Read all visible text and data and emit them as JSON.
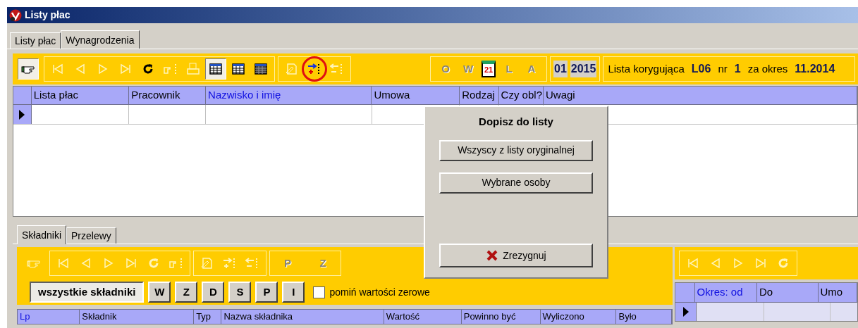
{
  "window": {
    "title": "Listy płac"
  },
  "tabs": [
    {
      "label": "Listy płac",
      "selected": false
    },
    {
      "label": "Wynagrodzenia",
      "selected": true
    }
  ],
  "toolbar": {
    "groups": [
      [
        {
          "kind": "pointer",
          "pressed": true,
          "disabled": false
        }
      ],
      [
        {
          "kind": "first",
          "pressed": false,
          "disabled": true
        },
        {
          "kind": "prev",
          "pressed": false,
          "disabled": true
        },
        {
          "kind": "next",
          "pressed": false,
          "disabled": true
        },
        {
          "kind": "last",
          "pressed": false,
          "disabled": true
        },
        {
          "kind": "refresh",
          "pressed": false,
          "disabled": false
        },
        {
          "kind": "handlist",
          "pressed": false,
          "disabled": true
        },
        {
          "kind": "printer",
          "pressed": false,
          "disabled": true
        },
        {
          "kind": "grida",
          "pressed": true,
          "disabled": false
        },
        {
          "kind": "gridb",
          "pressed": false,
          "disabled": false
        },
        {
          "kind": "gridc",
          "pressed": false,
          "disabled": false
        }
      ],
      [
        {
          "kind": "docedit",
          "pressed": false,
          "disabled": true
        },
        {
          "kind": "addlist",
          "pressed": false,
          "disabled": false,
          "highlighted": true
        },
        {
          "kind": "removelist",
          "pressed": false,
          "disabled": true
        }
      ]
    ],
    "letters": [
      {
        "label": "O",
        "kind": "letter",
        "disabled": true
      },
      {
        "label": "W",
        "kind": "letter",
        "disabled": true
      },
      {
        "kind": "calendar",
        "label": "21"
      },
      {
        "label": "L",
        "kind": "letter",
        "disabled": true
      },
      {
        "label": "A",
        "kind": "letter",
        "disabled": true
      }
    ],
    "period": {
      "month": "01",
      "year": "2015"
    },
    "info": [
      {
        "text": "Lista korygująca",
        "bold": false
      },
      {
        "text": "L06",
        "bold": true
      },
      {
        "text": "nr",
        "bold": false
      },
      {
        "text": "1",
        "bold": true
      },
      {
        "text": "za okres",
        "bold": false
      },
      {
        "text": "11.2014",
        "bold": true
      }
    ]
  },
  "grid": {
    "columns": [
      {
        "label": "Lista płac",
        "sorted": false
      },
      {
        "label": "Pracownik",
        "sorted": false
      },
      {
        "label": "Nazwisko i imię",
        "sorted": true
      },
      {
        "label": "Umowa",
        "sorted": false
      },
      {
        "label": "Rodzaj",
        "sorted": false
      },
      {
        "label": "Czy obl?",
        "sorted": false
      },
      {
        "label": "Uwagi",
        "sorted": false
      }
    ],
    "rows": [
      {
        "current": true
      }
    ]
  },
  "popup": {
    "title": "Dopisz do listy",
    "buttons": [
      "Wszyscy z listy oryginalnej",
      "Wybrane osoby"
    ],
    "cancel": "Zrezygnuj"
  },
  "lower_tabs": [
    {
      "label": "Składniki",
      "selected": true
    },
    {
      "label": "Przelewy",
      "selected": false
    }
  ],
  "lower_toolbar": {
    "groups": [
      [
        {
          "kind": "pointer",
          "pressed": false,
          "disabled": true
        }
      ],
      [
        {
          "kind": "first",
          "pressed": false,
          "disabled": true
        },
        {
          "kind": "prev",
          "pressed": false,
          "disabled": true
        },
        {
          "kind": "next",
          "pressed": false,
          "disabled": true
        },
        {
          "kind": "last",
          "pressed": false,
          "disabled": true
        },
        {
          "kind": "refresh",
          "pressed": false,
          "disabled": true
        },
        {
          "kind": "handlist",
          "pressed": false,
          "disabled": true
        }
      ],
      [
        {
          "kind": "docedit",
          "pressed": false,
          "disabled": true
        },
        {
          "kind": "addlist",
          "pressed": false,
          "disabled": true
        },
        {
          "kind": "removelist",
          "pressed": false,
          "disabled": true
        }
      ]
    ],
    "letters": [
      {
        "label": "P",
        "disabled": true
      },
      {
        "label": "Z",
        "disabled": true
      }
    ]
  },
  "filters": [
    {
      "label": "wszystkie składniki",
      "selected": true
    },
    {
      "label": "W",
      "selected": false
    },
    {
      "label": "Z",
      "selected": false
    },
    {
      "label": "D",
      "selected": false
    },
    {
      "label": "S",
      "selected": false
    },
    {
      "label": "P",
      "selected": false
    },
    {
      "label": "I",
      "selected": false
    }
  ],
  "skip_zero": {
    "label": "pomiń wartości zerowe",
    "checked": false
  },
  "lower_grid": {
    "columns": [
      {
        "label": "Lp",
        "sorted": true
      },
      {
        "label": "Składnik",
        "sorted": false
      },
      {
        "label": "Typ",
        "sorted": false
      },
      {
        "label": "Nazwa składnika",
        "sorted": false
      },
      {
        "label": "Wartość",
        "sorted": false
      },
      {
        "label": "Powinno być",
        "sorted": false
      },
      {
        "label": "Wyliczono",
        "sorted": false
      },
      {
        "label": "Było",
        "sorted": false
      }
    ]
  },
  "side": {
    "nav": [
      {
        "kind": "first",
        "pressed": false,
        "disabled": true
      },
      {
        "kind": "prev",
        "pressed": false,
        "disabled": true
      },
      {
        "kind": "next",
        "pressed": false,
        "disabled": true
      },
      {
        "kind": "last",
        "pressed": false,
        "disabled": true
      },
      {
        "kind": "refresh",
        "pressed": false,
        "disabled": true
      }
    ],
    "columns": [
      {
        "label": "Okres: od",
        "sorted": true
      },
      {
        "label": "Do",
        "sorted": false
      },
      {
        "label": "Umo",
        "sorted": false
      }
    ],
    "rows": [
      {
        "current": true
      }
    ]
  }
}
